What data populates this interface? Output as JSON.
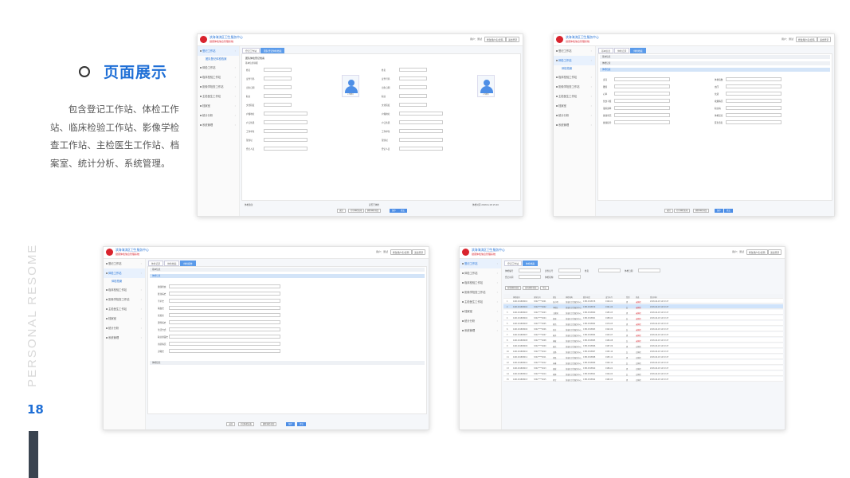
{
  "page": {
    "heading": "页面展示",
    "description": "包含登记工作站、体检工作站、临床检验工作站、影像学检查工作站、主检医生工作站、档案室、统计分析、系统管理。",
    "vertical_label": "PERSONAL  RESOME",
    "page_number": "18"
  },
  "app": {
    "title": "滨海海滨区卫生服务中心",
    "subtitle": "健康体检信息管理系统",
    "user": "用户：测试",
    "btn_modify": "修改用户名/密码",
    "btn_logout": "退出登录"
  },
  "sidebar": {
    "items": [
      "登记工作站",
      "体检工作站",
      "临床检验工作站",
      "影像学检查工作站",
      "主检医生工作站",
      "档案室",
      "统计分析",
      "系统管理"
    ],
    "sub_register": "团队登记体检档案",
    "sub_exam": "体检档案"
  },
  "shot1": {
    "crumbs": [
      "登记工作站",
      "团队登记体检档案"
    ],
    "section": "团队体检登记档案",
    "sub": "基本信息填报",
    "labels": [
      "姓名",
      "证件号码",
      "出生日期",
      "职业",
      "文化程度",
      "户籍地址",
      "户口性质",
      "工作单位",
      "现住址",
      "登记人员"
    ],
    "photo_caption": "上传照片",
    "remark": "体检备注",
    "confirm": "是否已体检",
    "date": "体检时间 2018-6-18 15:20",
    "buttons": [
      "返回",
      "打印体检表格",
      "删除体检档案",
      "保存",
      "提交"
    ]
  },
  "shot2": {
    "crumbs": [
      "基本信息",
      "体检记录",
      "体检档案"
    ],
    "bars": [
      "基本信息",
      "体检记录",
      "体检档案"
    ],
    "labels": [
      "身高",
      "体重指数",
      "腰围",
      "血压",
      "心率",
      "饮酒",
      "饮食习惯",
      "吸烟情况",
      "锻炼频率",
      "职业病",
      "健康状况",
      "体检结论",
      "健康指导",
      "医生签名"
    ],
    "buttons": [
      "返回",
      "打印体检表格",
      "删除体检档案",
      "保存",
      "提交"
    ]
  },
  "shot3": {
    "crumbs": [
      "体检记录",
      "体检档案",
      "体检报告"
    ],
    "bars": [
      "基本信息",
      "体检记录",
      "体检结论"
    ],
    "labels": [
      "健康状态",
      "既往病史",
      "手术史",
      "输血史",
      "家族史",
      "遗传病史",
      "生活方式",
      "职业暴露史",
      "用药情况",
      "过敏史"
    ],
    "buttons": [
      "返回",
      "打印体检表格",
      "删除体检档案",
      "保存",
      "提交"
    ]
  },
  "shot4": {
    "crumbs": [
      "登记工作站",
      "体检档案"
    ],
    "filters": [
      "体检编号",
      "身份证号",
      "姓名",
      "体检日期",
      "登记时间",
      "体检机构"
    ],
    "toolbar": [
      "新增体检档案",
      "查询体检档案",
      "导出"
    ],
    "columns": [
      "",
      "体检编号",
      "身份证号",
      "姓名",
      "体检机构",
      "联系电话",
      "出生年月",
      "性别",
      "状态",
      "登记时间"
    ],
    "status_pending": "未体检",
    "status_done": "已体检",
    "rows": [
      [
        "1",
        "4401201808001",
        "3202****0001",
        "张小明",
        "滨海区卫生服务中心",
        "13812345678",
        "1990-01",
        "男",
        "未体检",
        "2018-06-18 14:52:27"
      ],
      [
        "2",
        "4401201808002",
        "3202****0002",
        "李晓红",
        "滨海区卫生服务中心",
        "13812345679",
        "1991-02",
        "女",
        "未体检",
        "2018-06-18 14:52:27"
      ],
      [
        "3",
        "4401201808003",
        "3202****0003",
        "王建国",
        "滨海区卫生服务中心",
        "13812345680",
        "1985-03",
        "男",
        "未体检",
        "2018-06-18 14:52:27"
      ],
      [
        "4",
        "4401201808004",
        "3202****0004",
        "赵丽",
        "滨海区卫生服务中心",
        "13812345681",
        "1988-04",
        "女",
        "未体检",
        "2018-06-18 14:52:27"
      ],
      [
        "5",
        "4401201808005",
        "3202****0005",
        "陈伟",
        "滨海区卫生服务中心",
        "13812345682",
        "1979-05",
        "男",
        "未体检",
        "2018-06-18 14:52:27"
      ],
      [
        "6",
        "4401201808006",
        "3202****0006",
        "刘芳",
        "滨海区卫生服务中心",
        "13812345683",
        "1992-06",
        "女",
        "未体检",
        "2018-06-18 14:52:27"
      ],
      [
        "7",
        "4401201808007",
        "3202****0007",
        "杨洋",
        "滨海区卫生服务中心",
        "13812345684",
        "1993-07",
        "男",
        "未体检",
        "2018-06-18 14:52:27"
      ],
      [
        "8",
        "4401201808008",
        "3202****0008",
        "黄敏",
        "滨海区卫生服务中心",
        "13812345685",
        "1980-08",
        "女",
        "未体检",
        "2018-06-18 14:52:27"
      ],
      [
        "9",
        "4401201808009",
        "3202****0009",
        "周杰",
        "滨海区卫生服务中心",
        "13812345686",
        "1987-09",
        "男",
        "已体检",
        "2018-06-18 14:52:27"
      ],
      [
        "10",
        "4401201808010",
        "3202****0010",
        "吴静",
        "滨海区卫生服务中心",
        "13812345687",
        "1995-10",
        "女",
        "已体检",
        "2018-06-18 14:52:27"
      ],
      [
        "11",
        "4401201808011",
        "3202****0011",
        "孙磊",
        "滨海区卫生服务中心",
        "13812345688",
        "1983-11",
        "男",
        "已体检",
        "2018-06-18 14:52:27"
      ],
      [
        "12",
        "4401201808012",
        "3202****0012",
        "朱琳",
        "滨海区卫生服务中心",
        "13812345689",
        "1990-12",
        "女",
        "已体检",
        "2018-06-18 14:52:27"
      ],
      [
        "13",
        "4401201808013",
        "3202****0013",
        "胡斌",
        "滨海区卫生服务中心",
        "13812345690",
        "1986-01",
        "男",
        "已体检",
        "2018-06-18 14:52:27"
      ],
      [
        "14",
        "4401201808014",
        "3202****0014",
        "郭婷",
        "滨海区卫生服务中心",
        "13812345691",
        "1994-02",
        "女",
        "已体检",
        "2018-06-18 14:52:27"
      ],
      [
        "15",
        "4401201808015",
        "3202****0015",
        "何军",
        "滨海区卫生服务中心",
        "13812345692",
        "1982-03",
        "男",
        "已体检",
        "2018-06-18 14:52:27"
      ]
    ],
    "highlight_row": 1
  },
  "colors": {
    "accent": "#1f6fd6",
    "brand_red": "#d9232d",
    "bar": "#3a4450"
  }
}
